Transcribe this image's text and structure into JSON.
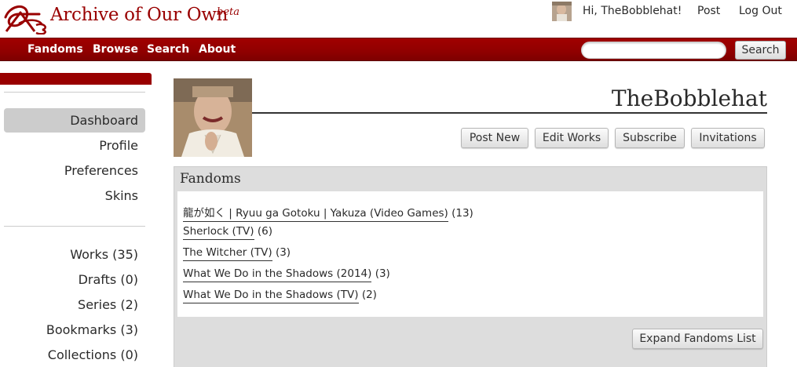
{
  "header": {
    "site_title": "Archive of Our Own",
    "beta": "beta",
    "greeting": "Hi, TheBobblehat!",
    "post": "Post",
    "logout": "Log Out"
  },
  "nav": {
    "items": [
      "Fandoms",
      "Browse",
      "Search",
      "About"
    ],
    "search_button": "Search",
    "search_placeholder": ""
  },
  "sidebar": {
    "group1": [
      "Dashboard",
      "Profile",
      "Preferences",
      "Skins"
    ],
    "group2": [
      "Works (35)",
      "Drafts (0)",
      "Series (2)",
      "Bookmarks (3)",
      "Collections (0)"
    ]
  },
  "profile": {
    "name": "TheBobblehat",
    "buttons": [
      "Post New",
      "Edit Works",
      "Subscribe",
      "Invitations"
    ]
  },
  "fandoms": {
    "title": "Fandoms",
    "items": [
      {
        "name": "龍が如く | Ryuu ga Gotoku | Yakuza (Video Games)",
        "count": "(13)"
      },
      {
        "name": "Sherlock (TV)",
        "count": "(6)"
      },
      {
        "name": "The Witcher (TV)",
        "count": "(3)"
      },
      {
        "name": "What We Do in the Shadows (2014)",
        "count": "(3)"
      },
      {
        "name": "What We Do in the Shadows (TV)",
        "count": "(2)"
      }
    ],
    "expand_button": "Expand Fandoms List"
  },
  "colors": {
    "brand_red": "#990000",
    "sidebar_active": "#cccccc",
    "box_gray": "#dddddd"
  }
}
